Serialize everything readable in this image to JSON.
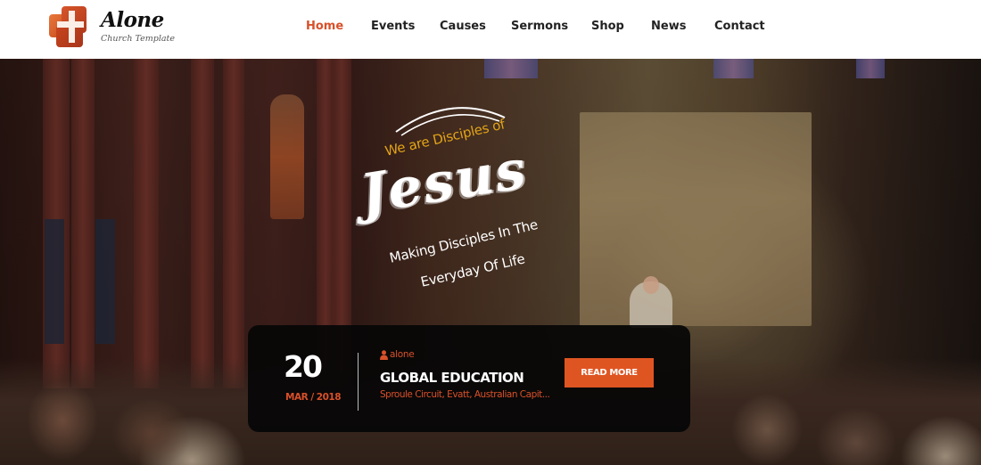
{
  "brand": {
    "title": "Alone",
    "subtitle": "Church Template",
    "logo_icon": "cross-logo-icon"
  },
  "nav": {
    "items": [
      {
        "label": "Home",
        "active": true
      },
      {
        "label": "Events",
        "active": false
      },
      {
        "label": "Causes",
        "active": false
      },
      {
        "label": "Sermons",
        "active": false
      },
      {
        "label": "Shop",
        "active": false
      },
      {
        "label": "News",
        "active": false
      },
      {
        "label": "Contact",
        "active": false
      }
    ]
  },
  "hero": {
    "tagline_small": "We  are Disciples of",
    "tagline_big": "Jesus",
    "tagline_line1": "Making Disciples In The",
    "tagline_line2": "Everyday Of Life"
  },
  "event": {
    "day": "20",
    "month_year": "MAR / 2018",
    "author_icon": "user-icon",
    "author": "alone",
    "title": "GLOBAL EDUCATION",
    "location": "Sproule Circuit, Evatt, Australian Capit...",
    "button_label": "READ MORE"
  },
  "colors": {
    "accent": "#d8502a",
    "button": "#df5522",
    "tagline_gold": "#e2a317",
    "card_bg": "#060606"
  }
}
